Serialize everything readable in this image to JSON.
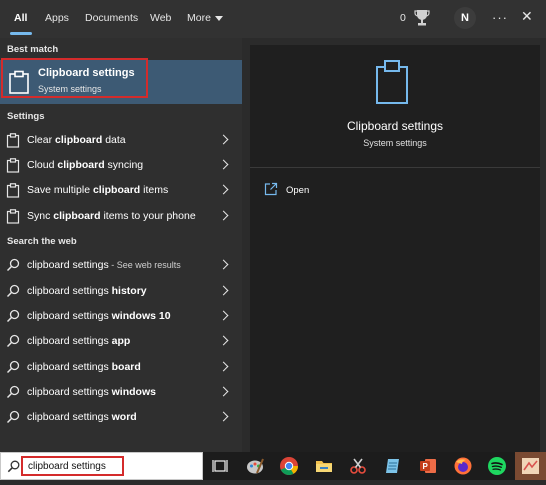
{
  "tabs": [
    {
      "label": "All",
      "active": true
    },
    {
      "label": "Apps"
    },
    {
      "label": "Documents"
    },
    {
      "label": "Web"
    },
    {
      "label": "More"
    }
  ],
  "header": {
    "points": "0",
    "avatar_initial": "N",
    "more_icon": "more-icon",
    "close_icon": "close-icon"
  },
  "best_match": {
    "heading": "Best match",
    "title": "Clipboard settings",
    "subtitle": "System settings",
    "icon": "clipboard-icon"
  },
  "settings": {
    "heading": "Settings",
    "items": [
      {
        "pre": "Clear ",
        "bold": "clipboard",
        "post": " data"
      },
      {
        "pre": "Cloud ",
        "bold": "clipboard",
        "post": " syncing"
      },
      {
        "pre": "Save multiple ",
        "bold": "clipboard",
        "post": " items"
      },
      {
        "pre": "Sync ",
        "bold": "clipboard",
        "post": " items to your phone"
      }
    ]
  },
  "web": {
    "heading": "Search the web",
    "items": [
      {
        "pre": "clipboard settings",
        "bold": "",
        "muted": " - See web results"
      },
      {
        "pre": "clipboard settings ",
        "bold": "history",
        "muted": ""
      },
      {
        "pre": "clipboard settings ",
        "bold": "windows 10",
        "muted": ""
      },
      {
        "pre": "clipboard settings ",
        "bold": "app",
        "muted": ""
      },
      {
        "pre": "clipboard settings ",
        "bold": "board",
        "muted": ""
      },
      {
        "pre": "clipboard settings ",
        "bold": "windows",
        "muted": ""
      },
      {
        "pre": "clipboard settings ",
        "bold": "word",
        "muted": ""
      }
    ]
  },
  "preview": {
    "title": "Clipboard settings",
    "subtitle": "System settings",
    "open_label": "Open"
  },
  "search": {
    "value": "clipboard settings"
  },
  "taskbar": {
    "icons": [
      "task-view-icon",
      "paint-icon",
      "chrome-icon",
      "file-explorer-icon",
      "snipping-tool-icon",
      "notepad-icon",
      "powerpoint-icon",
      "firefox-icon",
      "spotify-icon",
      "app-icon"
    ]
  },
  "colors": {
    "accent": "#76b9ed",
    "selection": "#3d5a74",
    "highlight_outline": "#d42b2b"
  }
}
